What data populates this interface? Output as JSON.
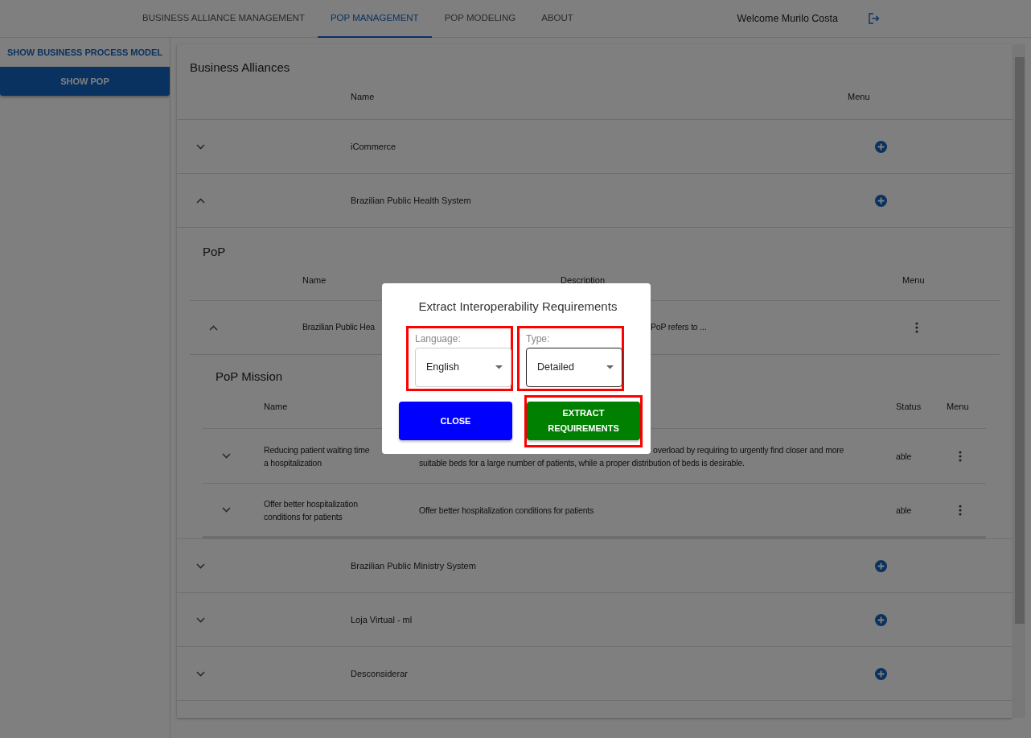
{
  "nav": {
    "tabs": [
      {
        "label": "BUSINESS ALLIANCE MANAGEMENT",
        "selected": false
      },
      {
        "label": "POP MANAGEMENT",
        "selected": true
      },
      {
        "label": "POP MODELING",
        "selected": false
      },
      {
        "label": "ABOUT",
        "selected": false
      }
    ],
    "welcome": "Welcome Murilo Costa"
  },
  "sidebar": {
    "items": [
      {
        "label": "SHOW BUSINESS PROCESS MODEL",
        "selected": false
      },
      {
        "label": "SHOW POP",
        "selected": true
      }
    ]
  },
  "alliances": {
    "title": "Business Alliances",
    "columns": [
      "Name",
      "Menu"
    ],
    "rows": [
      {
        "name": "iCommerce",
        "expanded": false
      },
      {
        "name": "Brazilian Public Health System",
        "expanded": true,
        "pop": {
          "title": "PoP",
          "columns": [
            "Name",
            "Description",
            "Menu"
          ],
          "rows": [
            {
              "name": "Brazilian Public Hea",
              "description": "PoP refers to ...",
              "expanded": true,
              "mission": {
                "title": "PoP Mission",
                "columns": [
                  {
                    "label": "Name",
                    "kind": "name"
                  },
                  {
                    "label": "Status",
                    "kind": "status"
                  },
                  {
                    "label": "Menu",
                    "kind": "menu"
                  }
                ],
                "rows": [
                  {
                    "name_lines": [
                      "Reducing patient waiting time",
                      "a hospitalization"
                    ],
                    "description_lines": [
                      "overload by requiring to urgently find closer and more",
                      "suitable beds for a large number of patients, while a proper distribution of beds is desirable."
                    ],
                    "status": "able",
                    "expanded": false
                  },
                  {
                    "name_lines": [
                      "Offer better hospitalization",
                      "conditions for patients"
                    ],
                    "description_lines": [
                      "Offer better hospitalization conditions for patients"
                    ],
                    "status": "able",
                    "expanded": false
                  }
                ]
              }
            }
          ]
        }
      },
      {
        "name": "Brazilian Public Ministry System",
        "expanded": false
      },
      {
        "name": "Loja Virtual - ml",
        "expanded": false
      },
      {
        "name": "Desconsiderar",
        "expanded": false
      }
    ]
  },
  "modal": {
    "title": "Extract Interoperability Requirements",
    "fields": [
      {
        "label": "Language:",
        "value": "English",
        "focused": false,
        "highlighted": true
      },
      {
        "label": "Type:",
        "value": "Detailed",
        "focused": true,
        "highlighted": true
      }
    ],
    "buttons": [
      {
        "label": "CLOSE",
        "kind": "close",
        "highlighted": false
      },
      {
        "label": "EXTRACT REQUIREMENTS",
        "kind": "extract",
        "highlighted": true
      }
    ]
  }
}
